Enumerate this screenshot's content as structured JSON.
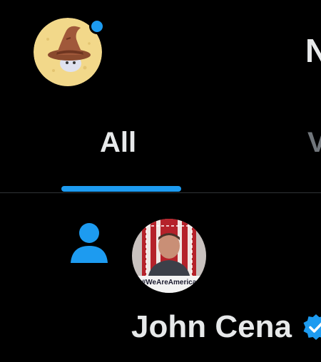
{
  "header": {
    "title": "N",
    "avatar": {
      "icon": "wizard-hat-avatar",
      "has_notification_dot": true
    }
  },
  "tabs": [
    {
      "label": "All",
      "selected": true
    },
    {
      "label": "V",
      "selected": false
    }
  ],
  "notification": {
    "type_icon": "person-icon",
    "user": {
      "name": "John Cena",
      "verified": true,
      "avatar_caption": "#WeAreAmerica"
    }
  },
  "colors": {
    "accent": "#1d9bf0",
    "background": "#000000",
    "text_primary": "#e7e9ea",
    "text_secondary": "#71767b"
  }
}
